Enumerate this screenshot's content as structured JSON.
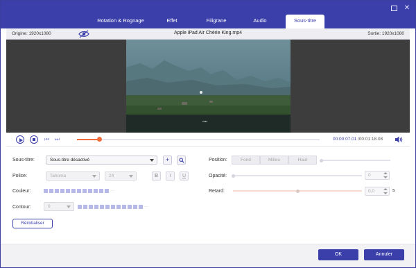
{
  "window": {
    "controls": {
      "minimize_icon": "restore-icon",
      "close_icon": "close-icon",
      "close_glyph": "✕"
    }
  },
  "tabs": [
    {
      "label": "Rotation & Rognage",
      "active": false
    },
    {
      "label": "Effet",
      "active": false
    },
    {
      "label": "Filigrane",
      "active": false
    },
    {
      "label": "Audio",
      "active": false
    },
    {
      "label": "Sous-titre",
      "active": true
    }
  ],
  "infobar": {
    "origin": "Origine: 1920x1080",
    "title": "Apple iPad Air Chérie King.mp4",
    "output": "Sortie: 1920x1080"
  },
  "video": {
    "subtitle_overlay": "●●●●"
  },
  "player": {
    "progress": 0.09,
    "time_current": "00:00:07.01",
    "time_total": "/00:01:18.08"
  },
  "form": {
    "subtitle_label": "Sous-titre:",
    "subtitle_value": "Sous-titre désactivé",
    "font_label": "Police:",
    "font_value": "Tahoma",
    "size_value": "24",
    "bold": "B",
    "italic": "I",
    "underline": "U",
    "color_label": "Couleur:",
    "outline_label": "Contour:",
    "outline_value": "0",
    "more_dots": "···",
    "position_label": "Position:",
    "position_options": [
      "Fond",
      "Milieu",
      "Haut"
    ],
    "opacity_label": "Opacité:",
    "opacity_value": "0",
    "opacity_level": 0.0,
    "delay_label": "Retard:",
    "delay_value": "0,0",
    "delay_unit": "s",
    "delay_level": 0.5,
    "reset_label": "Réinitialiser"
  },
  "footer": {
    "ok_label": "OK",
    "cancel_label": "Annuler"
  },
  "colors": {
    "accent": "#3b3faa",
    "progress": "#f26b3a",
    "swatch": "#b7b8ea"
  }
}
